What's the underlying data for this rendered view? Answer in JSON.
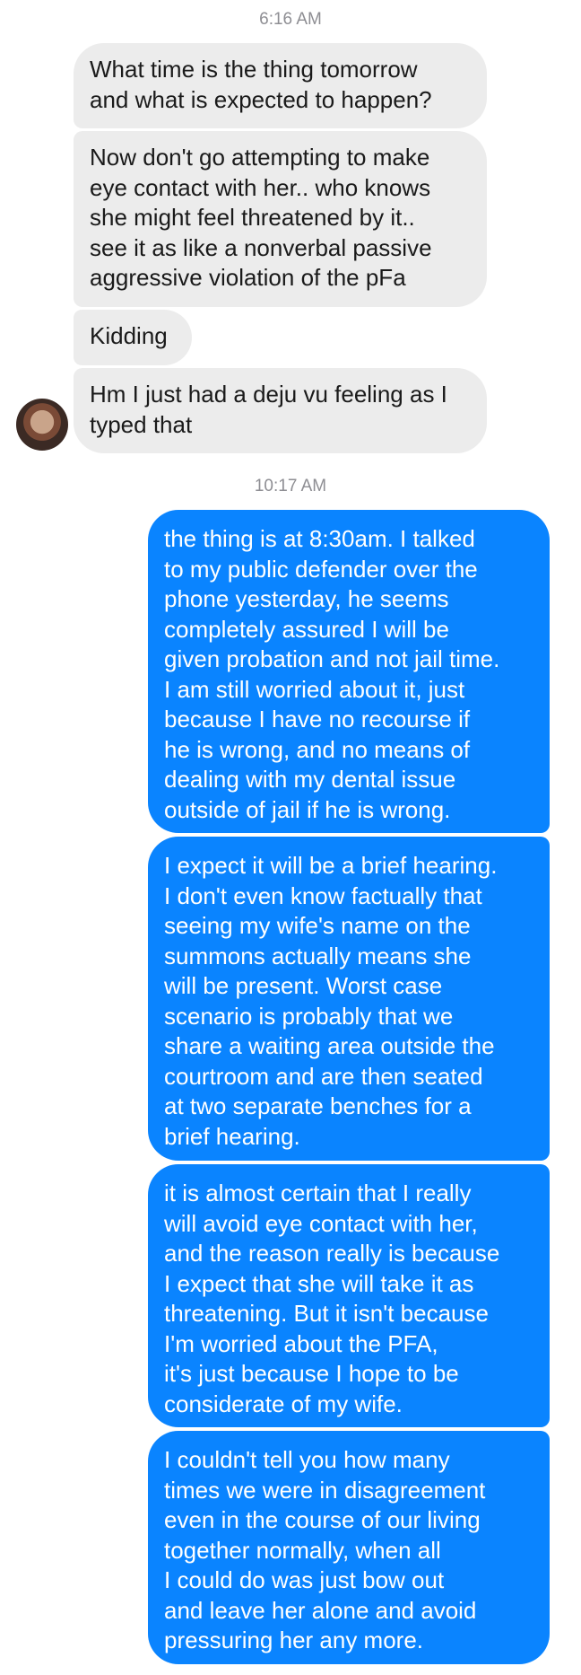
{
  "conversation": {
    "timestamp_1": "6:16 AM",
    "timestamp_2": "10:17 AM",
    "incoming": [
      "What time is the thing tomorrow\nand what is expected to happen?",
      "Now don't go attempting to make\neye contact with her.. who knows\nshe might feel threatened by it..\nsee it as like a nonverbal passive\naggressive violation of the pFa",
      "Kidding",
      "Hm I just had a deju vu feeling as I\ntyped that"
    ],
    "outgoing": [
      "the thing is at 8:30am. I talked\nto my public defender over the\nphone yesterday, he seems\ncompletely assured I will be\ngiven probation and not jail time.\nI am still worried about it, just\nbecause I have no recourse if\nhe is wrong, and no means of\ndealing with my dental issue\noutside of jail if he is wrong.",
      "I expect it will be a brief hearing.\nI don't even know factually that\nseeing my wife's name on the\nsummons actually means she\nwill be present. Worst case\nscenario is probably that we\nshare a waiting area outside the\ncourtroom and are then seated\nat two separate benches for a\nbrief hearing.",
      "it is almost certain that I really\nwill avoid eye contact with her,\nand the reason really is because\nI expect that she will take it as\nthreatening. But it isn't because\nI'm worried about the PFA,\nit's just because I hope to be\nconsiderate of my wife.",
      "I couldn't tell you how many\ntimes we were in disagreement\neven in the course of our living\ntogether normally, when all\nI could do was just bow out\nand leave her alone and avoid\npressuring her any more."
    ]
  },
  "colors": {
    "incoming_bubble": "#ececec",
    "outgoing_bubble": "#0a84ff",
    "timestamp_text": "#8e8e93"
  },
  "icons": {
    "avatar": "contact-avatar-photo"
  }
}
